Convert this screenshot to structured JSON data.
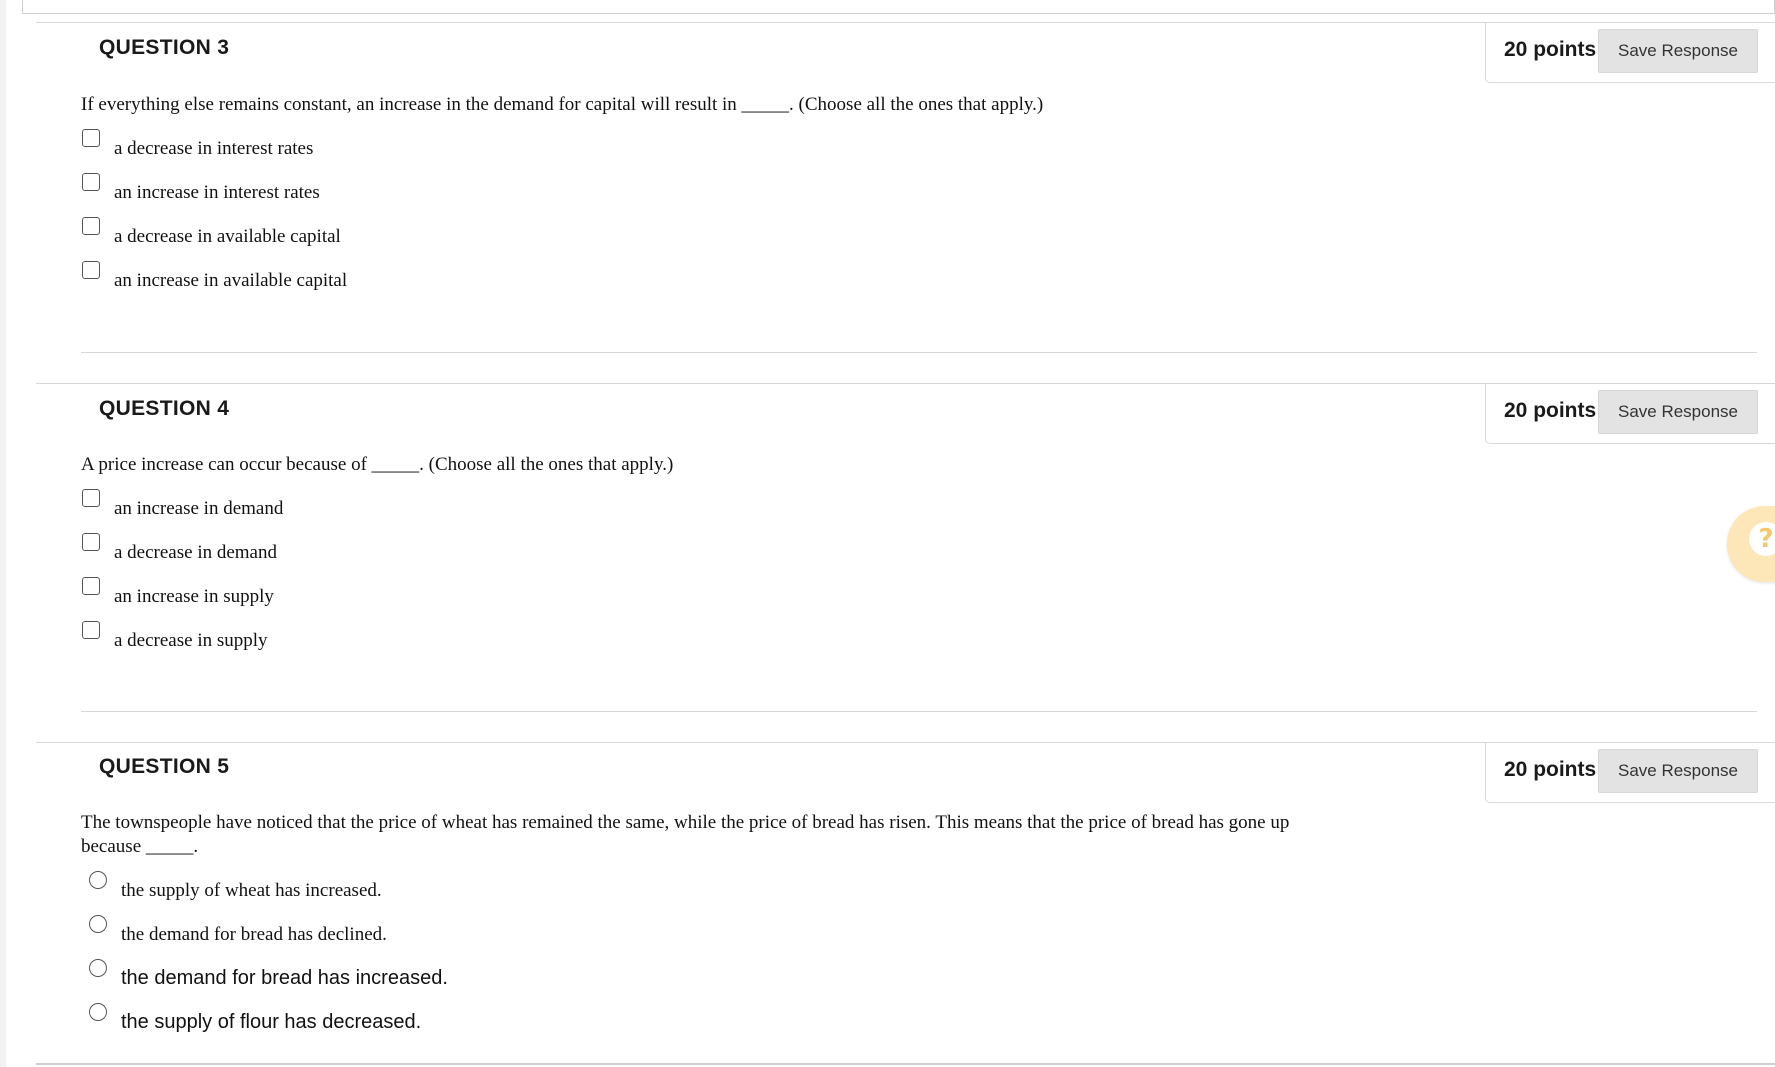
{
  "questions": [
    {
      "title": "QUESTION 3",
      "points": "20 points",
      "save_label": "Save Response",
      "text": "If everything else remains constant, an increase in the demand for capital will result in _____. (Choose all the ones that apply.)",
      "input_type": "checkbox",
      "options": [
        "a decrease in interest rates",
        "an increase in interest rates",
        "a decrease in available capital",
        "an increase in available capital"
      ]
    },
    {
      "title": "QUESTION 4",
      "points": "20 points",
      "save_label": "Save Response",
      "text": "A price increase can occur because of _____. (Choose all the ones that apply.)",
      "input_type": "checkbox",
      "options": [
        "an increase in demand",
        "a decrease in demand",
        "an increase in supply",
        "a decrease in supply"
      ]
    },
    {
      "title": "QUESTION 5",
      "points": "20 points",
      "save_label": "Save Response",
      "text_line1": "The townspeople have noticed that the price of wheat has remained the same, while the price of bread has risen. This means that the price of bread has gone up",
      "text_line2": "because _____.",
      "input_type": "radio",
      "options": [
        "the supply of wheat has increased.",
        "the demand for bread has declined.",
        "the demand for bread has increased.",
        "the supply of flour has decreased."
      ]
    }
  ],
  "help": {
    "icon": "question-mark-icon",
    "glyph": "?",
    "color": "#fde6b8"
  }
}
